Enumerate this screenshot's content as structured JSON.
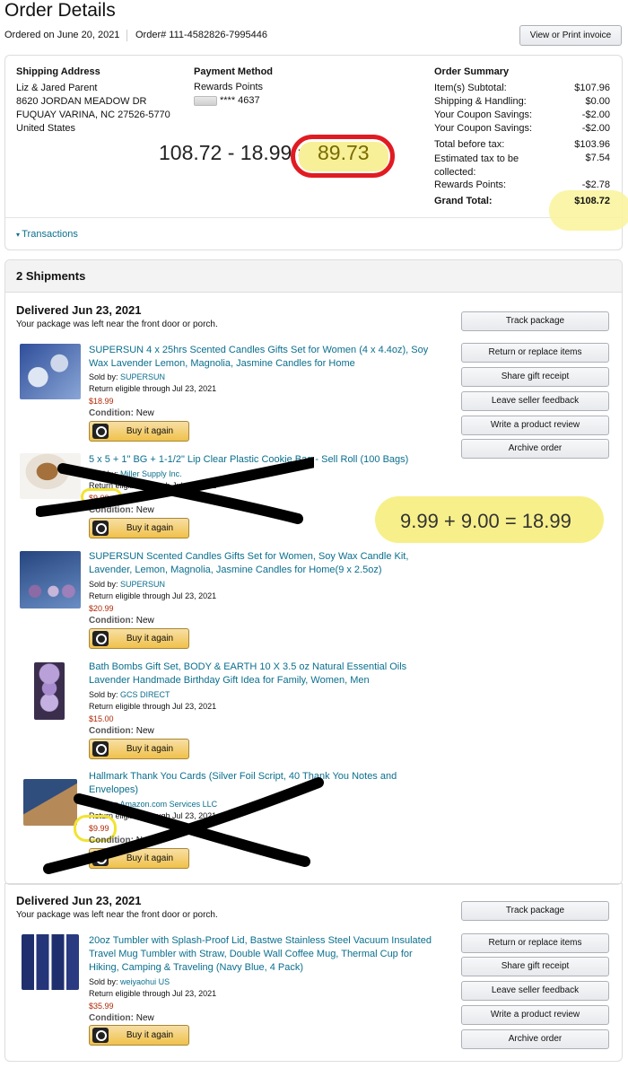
{
  "page": {
    "title": "Order Details",
    "ordered_on": "Ordered on June 20, 2021",
    "order_number": "Order# 111-4582826-7995446",
    "view_print": "View or Print invoice"
  },
  "shipping": {
    "heading": "Shipping Address",
    "lines": [
      "Liz & Jared Parent",
      "8620 JORDAN MEADOW DR",
      "FUQUAY VARINA, NC 27526-5770",
      "United States"
    ]
  },
  "payment": {
    "heading": "Payment Method",
    "method": "Rewards Points",
    "card": "**** 4637"
  },
  "summary": {
    "heading": "Order Summary",
    "rows": [
      {
        "label": "Item(s) Subtotal:",
        "value": "$107.96"
      },
      {
        "label": "Shipping & Handling:",
        "value": "$0.00"
      },
      {
        "label": "Your Coupon Savings:",
        "value": "-$2.00"
      },
      {
        "label": "Your Coupon Savings:",
        "value": "-$2.00"
      },
      {
        "label": "Total before tax:",
        "value": "$103.96"
      },
      {
        "label": "Estimated tax to be collected:",
        "value": "$7.54"
      },
      {
        "label": "Rewards Points:",
        "value": "-$2.78"
      }
    ],
    "grand_label": "Grand Total:",
    "grand_value": "$108.72"
  },
  "annotations": {
    "equation_left": "108.72 - 18.99 =",
    "equation_result": "89.73",
    "equation_sum": "9.99 + 9.00 = 18.99"
  },
  "transactions": "Transactions",
  "shipments_heading": "2 Shipments",
  "shipment1": {
    "delivered": "Delivered Jun 23, 2021",
    "note": "Your package was left near the front door or porch.",
    "actions": [
      "Track package",
      "Return or replace items",
      "Share gift receipt",
      "Leave seller feedback",
      "Write a product review",
      "Archive order"
    ],
    "items": [
      {
        "title": "SUPERSUN 4 x 25hrs Scented Candles Gifts Set for Women (4 x 4.4oz), Soy Wax Lavender Lemon, Magnolia, Jasmine Candles for Home",
        "sold_by_label": "Sold by:",
        "seller": "SUPERSUN",
        "return": "Return eligible through Jul 23, 2021",
        "price": "$18.99",
        "condition_label": "Condition:",
        "condition": "New",
        "buy": "Buy it again"
      },
      {
        "title": "5 x 5 + 1\" BG + 1-1/2\" Lip Clear Plastic Cookie Bag - Sell Roll (100 Bags)",
        "sold_by_label": "Sold by:",
        "seller": "Miller Supply Inc.",
        "return": "Return eligible through Jul 23, 2021",
        "price": "$9.00",
        "condition_label": "Condition:",
        "condition": "New",
        "buy": "Buy it again"
      },
      {
        "title": "SUPERSUN Scented Candles Gifts Set for Women, Soy Wax Candle Kit, Lavender, Lemon, Magnolia, Jasmine Candles for Home(9 x 2.5oz)",
        "sold_by_label": "Sold by:",
        "seller": "SUPERSUN",
        "return": "Return eligible through Jul 23, 2021",
        "price": "$20.99",
        "condition_label": "Condition:",
        "condition": "New",
        "buy": "Buy it again"
      },
      {
        "title": "Bath Bombs Gift Set, BODY & EARTH 10 X 3.5 oz Natural Essential Oils Lavender Handmade Birthday Gift Idea for Family, Women, Men",
        "sold_by_label": "Sold by:",
        "seller": "GCS DIRECT",
        "return": "Return eligible through Jul 23, 2021",
        "price": "$15.00",
        "condition_label": "Condition:",
        "condition": "New",
        "buy": "Buy it again"
      },
      {
        "title": "Hallmark Thank You Cards (Silver Foil Script, 40 Thank You Notes and Envelopes)",
        "sold_by_label": "Sold by:",
        "seller": "Amazon.com Services LLC",
        "return": "Return eligible through Jul 23, 2021",
        "price": "$9.99",
        "condition_label": "Condition:",
        "condition": "New",
        "buy": "Buy it again"
      }
    ]
  },
  "shipment2": {
    "delivered": "Delivered Jun 23, 2021",
    "note": "Your package was left near the front door or porch.",
    "actions": [
      "Track package",
      "Return or replace items",
      "Share gift receipt",
      "Leave seller feedback",
      "Write a product review",
      "Archive order"
    ],
    "item": {
      "title": "20oz Tumbler with Splash-Proof Lid, Bastwe Stainless Steel Vacuum Insulated Travel Mug Tumbler with Straw, Double Wall Coffee Mug, Thermal Cup for Hiking, Camping & Traveling (Navy Blue, 4 Pack)",
      "sold_by_label": "Sold by:",
      "seller": "weiyaohui US",
      "return": "Return eligible through Jul 23, 2021",
      "price": "$35.99",
      "condition_label": "Condition:",
      "condition": "New",
      "buy": "Buy it again"
    }
  }
}
